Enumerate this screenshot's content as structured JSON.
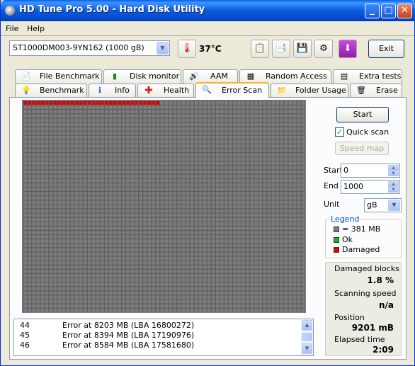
{
  "window": {
    "title": "HD Tune Pro 5.00 - Hard Disk Utility"
  },
  "menu": {
    "file": "File",
    "help": "Help"
  },
  "toolbar": {
    "drive": "ST1000DM003-9YN162 (1000 gB)",
    "temperature": "37°C",
    "exit_label": "Exit"
  },
  "tabs_top": [
    {
      "label": "File Benchmark",
      "icon": "file-benchmark-icon"
    },
    {
      "label": "Disk monitor",
      "icon": "disk-monitor-icon"
    },
    {
      "label": "AAM",
      "icon": "speaker-icon"
    },
    {
      "label": "Random Access",
      "icon": "random-access-icon"
    },
    {
      "label": "Extra tests",
      "icon": "extra-tests-icon"
    }
  ],
  "tabs_bottom": [
    {
      "label": "Benchmark",
      "icon": "lightbulb-icon"
    },
    {
      "label": "Info",
      "icon": "info-icon"
    },
    {
      "label": "Health",
      "icon": "health-cross-icon"
    },
    {
      "label": "Error Scan",
      "icon": "magnifier-icon"
    },
    {
      "label": "Folder Usage",
      "icon": "folder-icon"
    },
    {
      "label": "Erase",
      "icon": "trash-icon"
    }
  ],
  "scan": {
    "grid_cols": 66,
    "grid_rows": 49,
    "scanned_blocks": 32,
    "colors": {
      "untested": "#7d7d7d",
      "ok": "#00c800",
      "damaged": "#e60000",
      "grid_line": "#5f5f5f"
    }
  },
  "log": [
    {
      "num": "44",
      "msg": "Error at 8203 MB (LBA 16800272)"
    },
    {
      "num": "45",
      "msg": "Error at 8394 MB (LBA 17190976)"
    },
    {
      "num": "46",
      "msg": "Error at 8584 MB (LBA 17581680)"
    }
  ],
  "controls": {
    "start_label": "Start",
    "quick_scan_label": "Quick scan",
    "quick_scan_checked": true,
    "speed_map_label": "Speed map",
    "start_field_label": "Start",
    "start_value": "0",
    "end_field_label": "End",
    "end_value": "1000",
    "unit_label": "Unit",
    "unit_value": "gB"
  },
  "legend": {
    "title": "Legend",
    "block": "= 381 MB",
    "ok": "Ok",
    "damaged": "Damaged"
  },
  "stats": {
    "damaged_label": "Damaged blocks",
    "damaged_value": "1.8 %",
    "speed_label": "Scanning speed",
    "speed_value": "n/a",
    "position_label": "Position",
    "position_value": "9201 mB",
    "elapsed_label": "Elapsed time",
    "elapsed_value": "2:09"
  }
}
